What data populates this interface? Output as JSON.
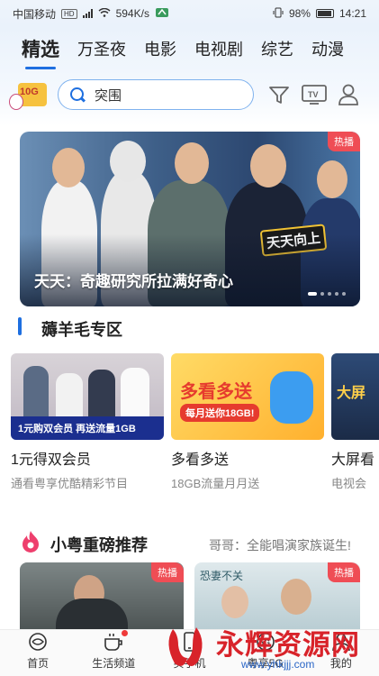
{
  "status_bar": {
    "carrier": "中国移动",
    "speed": "594K/s",
    "battery": "98%",
    "time": "14:21"
  },
  "tabs": [
    {
      "label": "精选",
      "active": true
    },
    {
      "label": "万圣夜",
      "active": false
    },
    {
      "label": "电影",
      "active": false
    },
    {
      "label": "电视剧",
      "active": false
    },
    {
      "label": "综艺",
      "active": false
    },
    {
      "label": "动漫",
      "active": false
    }
  ],
  "promo": {
    "badge": "10G"
  },
  "search": {
    "placeholder": "突围"
  },
  "header_icons": [
    "filter-icon",
    "tv-icon",
    "profile-icon"
  ],
  "banner": {
    "badge": "热播",
    "title": "天天：奇趣研究所拉满好奇心",
    "logo_text": "天天向上",
    "slide_count": 5,
    "active_slide": 0
  },
  "section1": {
    "title": "薅羊毛专区",
    "cards": [
      {
        "title": "1元得双会员",
        "subtitle": "通看粤享优酷精彩节目",
        "image_text": "1元购双会员  再送流量1GB"
      },
      {
        "title": "多看多送",
        "subtitle": "18GB流量月月送",
        "image_heading": "多看多送",
        "image_text": "每月送你18GB!"
      },
      {
        "title": "大屏看",
        "subtitle": "电视会",
        "image_text": "大屏"
      }
    ]
  },
  "section2": {
    "title": "小粤重磅推荐",
    "subtitle": "哥哥：全能唱演家族诞生!",
    "posters": [
      {
        "badge": "热播"
      },
      {
        "badge": "热播",
        "title_text": "恐妻不关"
      }
    ]
  },
  "bottom_nav": [
    {
      "label": "首页",
      "icon": "home-icon"
    },
    {
      "label": "生活频道",
      "icon": "cup-icon"
    },
    {
      "label": "买手机",
      "icon": "phone-icon"
    },
    {
      "label": "粤享5G",
      "icon": "5g-icon"
    },
    {
      "label": "我的",
      "icon": "user-icon"
    }
  ],
  "watermark": {
    "title": "永辉资源网",
    "url": "www.yhkjjj.com"
  },
  "colors": {
    "accent": "#1e6fe0",
    "hot_badge": "#ef4d55",
    "watermark": "#d8232a"
  }
}
